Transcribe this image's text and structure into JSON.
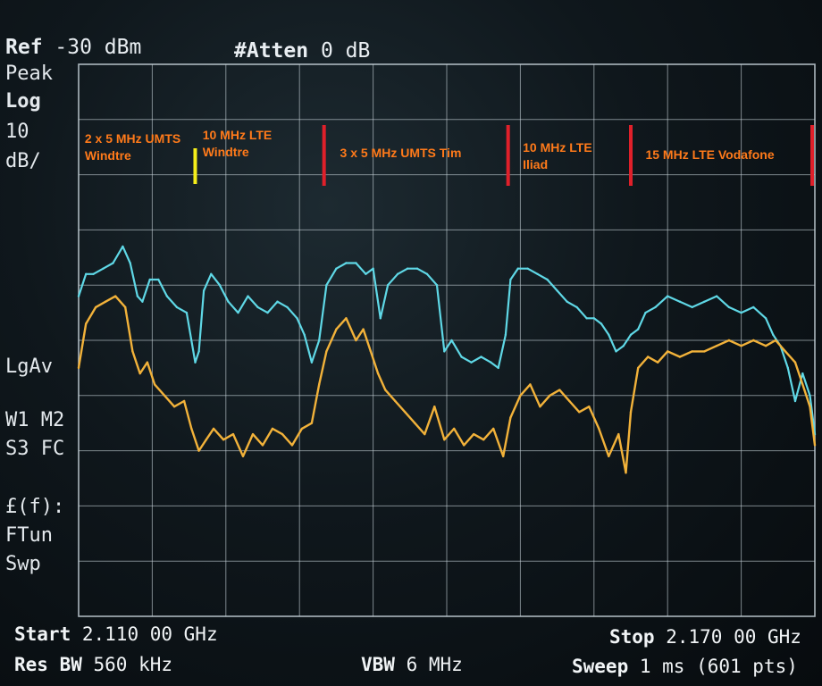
{
  "header": {
    "ref_label": "Ref",
    "ref_value": "-30 dBm",
    "atten_label": "#Atten",
    "atten_value": "0 dB"
  },
  "side": {
    "detector": "Peak",
    "scale_type": "Log",
    "scale_value": "10",
    "scale_unit": "dB/",
    "avg_mode": "LgAv",
    "markers_line1": "W1  M2",
    "markers_line2": "S3  FC",
    "func_line1": "£(f):",
    "func_line2": "FTun",
    "func_line3": "Swp"
  },
  "footer": {
    "start_label": "Start",
    "start_value": "2.110 00 GHz",
    "stop_label": "Stop",
    "stop_value": "2.170 00 GHz",
    "rbw_label": "Res BW",
    "rbw_value": "560 kHz",
    "vbw_label": "VBW",
    "vbw_value": "6 MHz",
    "sweep_label": "Sweep",
    "sweep_value": "1 ms (601 pts)"
  },
  "colors": {
    "grid": "#c8d4da",
    "trace_max": "#5fd8e6",
    "trace_avg": "#f2b23a",
    "band_label": "#ff7a1a",
    "divider_red": "#e0202a",
    "divider_yellow": "#f5ee1a"
  },
  "chart_data": {
    "type": "line",
    "x_unit": "GHz",
    "y_unit": "dBm",
    "xlim": [
      2.11,
      2.17
    ],
    "ylim": [
      -130,
      -30
    ],
    "grid": true,
    "grid_divisions": {
      "x": 10,
      "y": 10
    },
    "band_labels": [
      {
        "lines": [
          "2 x 5 MHz UMTS",
          "Windtre"
        ],
        "x": 2.1105
      },
      {
        "lines": [
          "10 MHz LTE",
          "Windtre"
        ],
        "x": 2.1201
      },
      {
        "lines": [
          "3 x 5 MHz UMTS Tim"
        ],
        "x": 2.1313
      },
      {
        "lines": [
          "10 MHz LTE",
          "Iliad"
        ],
        "x": 2.1462
      },
      {
        "lines": [
          "15 MHz LTE Vodafone"
        ],
        "x": 2.1562
      }
    ],
    "dividers": [
      {
        "x": 2.1195,
        "color": "yellow"
      },
      {
        "x": 2.13,
        "color": "red"
      },
      {
        "x": 2.145,
        "color": "red"
      },
      {
        "x": 2.155,
        "color": "red"
      },
      {
        "x": 2.17,
        "color": "red"
      }
    ],
    "series": [
      {
        "id": "max",
        "x": [
          2.11,
          2.1106,
          2.1112,
          2.112,
          2.1128,
          2.1136,
          2.1142,
          2.1148,
          2.1152,
          2.1158,
          2.1165,
          2.1172,
          2.118,
          2.1188,
          2.1195,
          2.1198,
          2.1202,
          2.1208,
          2.1215,
          2.1222,
          2.123,
          2.1238,
          2.1246,
          2.1254,
          2.1262,
          2.127,
          2.1278,
          2.1284,
          2.129,
          2.1296,
          2.1302,
          2.131,
          2.1318,
          2.1326,
          2.1334,
          2.134,
          2.1346,
          2.1352,
          2.136,
          2.1368,
          2.1376,
          2.1384,
          2.1392,
          2.1398,
          2.1404,
          2.1412,
          2.142,
          2.1428,
          2.1436,
          2.1442,
          2.1448,
          2.1452,
          2.1458,
          2.1466,
          2.1474,
          2.1482,
          2.149,
          2.1498,
          2.1506,
          2.1514,
          2.152,
          2.1526,
          2.1532,
          2.1538,
          2.1544,
          2.155,
          2.1556,
          2.1562,
          2.157,
          2.158,
          2.159,
          2.16,
          2.161,
          2.162,
          2.163,
          2.164,
          2.165,
          2.166,
          2.1666,
          2.1672,
          2.1678,
          2.1684,
          2.169,
          2.1696,
          2.17
        ],
        "y": [
          -72,
          -68,
          -68,
          -67,
          -66,
          -63,
          -66,
          -72,
          -73,
          -69,
          -69,
          -72,
          -74,
          -75,
          -84,
          -82,
          -71,
          -68,
          -70,
          -73,
          -75,
          -72,
          -74,
          -75,
          -73,
          -74,
          -76,
          -79,
          -84,
          -80,
          -70,
          -67,
          -66,
          -66,
          -68,
          -67,
          -76,
          -70,
          -68,
          -67,
          -67,
          -68,
          -70,
          -82,
          -80,
          -83,
          -84,
          -83,
          -84,
          -85,
          -79,
          -69,
          -67,
          -67,
          -68,
          -69,
          -71,
          -73,
          -74,
          -76,
          -76,
          -77,
          -79,
          -82,
          -81,
          -79,
          -78,
          -75,
          -74,
          -72,
          -73,
          -74,
          -73,
          -72,
          -74,
          -75,
          -74,
          -76,
          -79,
          -81,
          -85,
          -91,
          -86,
          -90,
          -97
        ]
      },
      {
        "id": "avg",
        "x": [
          2.11,
          2.1106,
          2.1114,
          2.1122,
          2.113,
          2.1138,
          2.1144,
          2.115,
          2.1156,
          2.1162,
          2.117,
          2.1178,
          2.1186,
          2.1192,
          2.1198,
          2.1204,
          2.121,
          2.1218,
          2.1226,
          2.1234,
          2.1242,
          2.125,
          2.1258,
          2.1266,
          2.1274,
          2.1282,
          2.129,
          2.1296,
          2.1302,
          2.131,
          2.1318,
          2.1326,
          2.1332,
          2.1338,
          2.1344,
          2.135,
          2.1358,
          2.1366,
          2.1374,
          2.1382,
          2.139,
          2.1398,
          2.1406,
          2.1414,
          2.1422,
          2.143,
          2.1438,
          2.1446,
          2.1452,
          2.146,
          2.1468,
          2.1476,
          2.1484,
          2.1492,
          2.15,
          2.1508,
          2.1516,
          2.1524,
          2.1532,
          2.154,
          2.1546,
          2.155,
          2.1556,
          2.1564,
          2.1572,
          2.158,
          2.159,
          2.16,
          2.161,
          2.162,
          2.163,
          2.164,
          2.165,
          2.166,
          2.1668,
          2.1676,
          2.1684,
          2.169,
          2.1696,
          2.17
        ],
        "y": [
          -85,
          -77,
          -74,
          -73,
          -72,
          -74,
          -82,
          -86,
          -84,
          -88,
          -90,
          -92,
          -91,
          -96,
          -100,
          -98,
          -96,
          -98,
          -97,
          -101,
          -97,
          -99,
          -96,
          -97,
          -99,
          -96,
          -95,
          -88,
          -82,
          -78,
          -76,
          -80,
          -78,
          -82,
          -86,
          -89,
          -91,
          -93,
          -95,
          -97,
          -92,
          -98,
          -96,
          -99,
          -97,
          -98,
          -96,
          -101,
          -94,
          -90,
          -88,
          -92,
          -90,
          -89,
          -91,
          -93,
          -92,
          -96,
          -101,
          -97,
          -104,
          -93,
          -85,
          -83,
          -84,
          -82,
          -83,
          -82,
          -82,
          -81,
          -80,
          -81,
          -80,
          -81,
          -80,
          -82,
          -84,
          -88,
          -92,
          -99
        ]
      }
    ]
  }
}
